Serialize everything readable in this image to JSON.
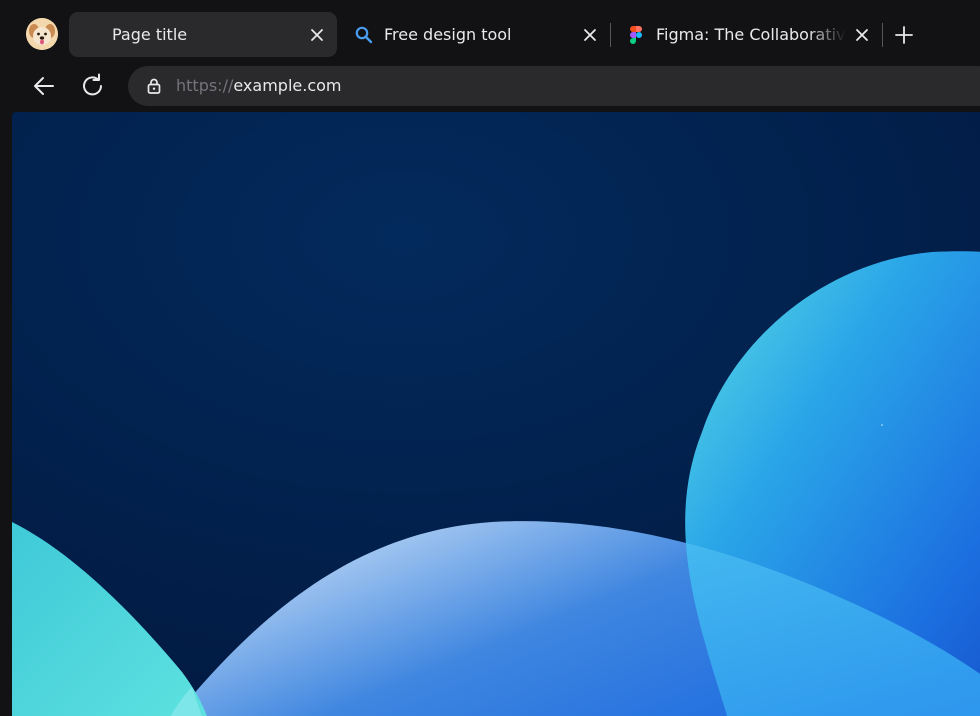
{
  "browser": {
    "tabs": [
      {
        "title": "Page title",
        "active": true,
        "icon": "none"
      },
      {
        "title": "Free design tool",
        "active": false,
        "icon": "search-icon"
      },
      {
        "title": "Figma: The Collaborative",
        "active": false,
        "icon": "figma-icon"
      }
    ],
    "address_bar": {
      "scheme": "https://",
      "host": "example.com"
    }
  },
  "icons": {
    "profile": "avatar",
    "tab_close": "close-icon",
    "new_tab": "plus-icon",
    "back": "arrow-left-icon",
    "reload": "reload-icon",
    "secure": "lock-icon"
  },
  "colors": {
    "chrome_bg": "#121214",
    "tab_active_bg": "#2a2a2d",
    "text": "#e9e9ec",
    "url_scheme": "#74747b",
    "page_bg": "#021d4d",
    "blob_cyan": "#5ddbe3",
    "blob_blue": "#1f7de6",
    "search_icon": "#4a9df0"
  }
}
